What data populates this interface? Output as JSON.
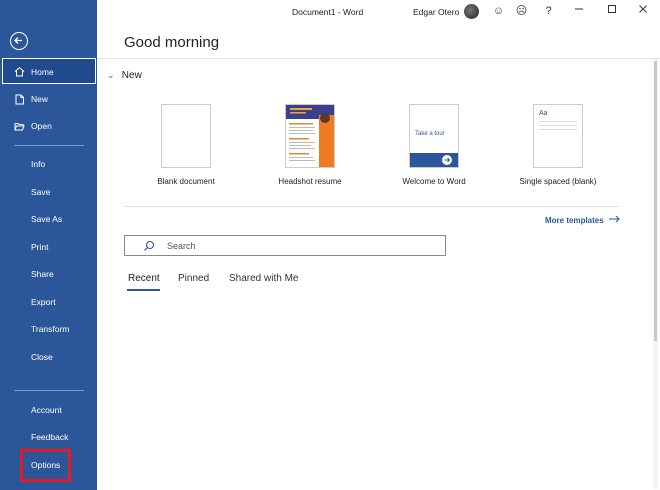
{
  "window": {
    "doc_title": "Document1  -  Word",
    "user_name": "Edgar Otero"
  },
  "sidebar": {
    "items": [
      {
        "label": "Home",
        "icon": "home-icon"
      },
      {
        "label": "New",
        "icon": "new-document-icon"
      },
      {
        "label": "Open",
        "icon": "folder-open-icon"
      },
      {
        "label": "Info"
      },
      {
        "label": "Save"
      },
      {
        "label": "Save As"
      },
      {
        "label": "Print"
      },
      {
        "label": "Share"
      },
      {
        "label": "Export"
      },
      {
        "label": "Transform"
      },
      {
        "label": "Close"
      },
      {
        "label": "Account"
      },
      {
        "label": "Feedback"
      },
      {
        "label": "Options"
      }
    ]
  },
  "main": {
    "greeting": "Good morning",
    "new_section_title": "New",
    "templates": [
      {
        "label": "Blank document"
      },
      {
        "label": "Headshot resume"
      },
      {
        "label": "Welcome to Word",
        "thumb_text": "Take a tour"
      },
      {
        "label": "Single spaced (blank)",
        "thumb_text": "Aa"
      }
    ],
    "more_templates": "More templates",
    "search": {
      "placeholder": "Search"
    },
    "tabs": [
      {
        "label": "Recent"
      },
      {
        "label": "Pinned"
      },
      {
        "label": "Shared with Me"
      }
    ]
  },
  "colors": {
    "accent": "#2b579a",
    "highlight": "#e51a23"
  }
}
